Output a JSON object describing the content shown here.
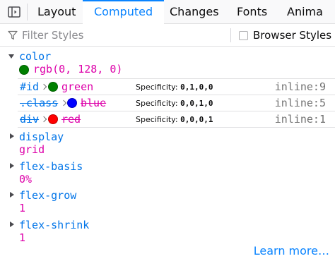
{
  "tabs": [
    {
      "label": "Layout"
    },
    {
      "label": "Computed"
    },
    {
      "label": "Changes"
    },
    {
      "label": "Fonts"
    },
    {
      "label": "Anima"
    }
  ],
  "active_tab": "Computed",
  "filter": {
    "placeholder": "Filter Styles",
    "value": ""
  },
  "browser_styles": {
    "label": "Browser Styles",
    "checked": false
  },
  "colors": {
    "accent": "#0a84ff",
    "property_name": "#0074e8",
    "property_value": "#dd00a9"
  },
  "properties": [
    {
      "name": "color",
      "value": "rgb(0, 128, 0)",
      "swatch": "#008000",
      "expanded": true,
      "matches": [
        {
          "selector": "#id",
          "value": "green",
          "swatch": "#008000",
          "specificity_label": "Specificity:",
          "specificity": "0,1,0,0",
          "source": "inline:9",
          "overridden": false
        },
        {
          "selector": ".class",
          "value": "blue",
          "swatch": "#0000ff",
          "specificity_label": "Specificity:",
          "specificity": "0,0,1,0",
          "source": "inline:5",
          "overridden": true
        },
        {
          "selector": "div",
          "value": "red",
          "swatch": "#ff0000",
          "specificity_label": "Specificity:",
          "specificity": "0,0,0,1",
          "source": "inline:1",
          "overridden": true
        }
      ]
    },
    {
      "name": "display",
      "value": "grid",
      "expanded": false
    },
    {
      "name": "flex-basis",
      "value": "0%",
      "expanded": false
    },
    {
      "name": "flex-grow",
      "value": "1",
      "expanded": false
    },
    {
      "name": "flex-shrink",
      "value": "1",
      "expanded": false
    }
  ],
  "learn_more": "Learn more…",
  "icons": {
    "sidebar_toggle": "sidebar-toggle-icon",
    "filter": "filter-funnel-icon"
  }
}
